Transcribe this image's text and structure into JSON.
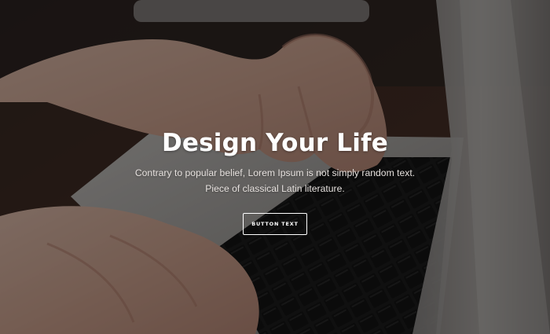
{
  "hero": {
    "title": "Design Your Life",
    "subtitle": "Contrary to popular belief, Lorem Ipsum is not simply random text. Piece of classical Latin literature.",
    "button_label": "BUTTON TEXT",
    "background_image": "laptop-typing-photo",
    "colors": {
      "text": "#ffffff",
      "overlay": "rgba(0,0,0,0.45)",
      "button_border": "#ffffff"
    }
  }
}
